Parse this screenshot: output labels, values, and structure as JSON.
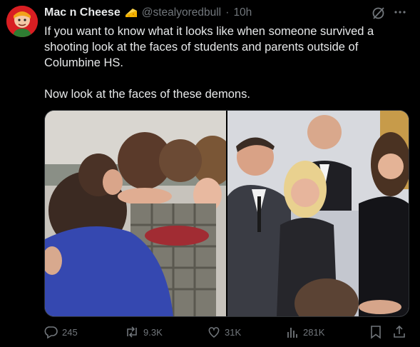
{
  "tweet": {
    "author_name": "Mac n Cheese",
    "author_emoji": "cheese-emoji",
    "handle": "@stealyoredbull",
    "separator": "·",
    "time": "10h",
    "text_paragraph_1": "If you want to know what it looks like when someone survived a shooting look at the faces of students and parents outside of Columbine HS.",
    "text_paragraph_2": "Now look at the faces of these demons.",
    "media": {
      "left_image": "photo-grieving-students-hugging",
      "right_image": "photo-smiling-group-formal-event"
    },
    "stats": {
      "replies": "245",
      "reposts": "9.3K",
      "likes": "31K",
      "views": "281K"
    }
  },
  "colors": {
    "background": "#000000",
    "text": "#e7e9ea",
    "secondary": "#71767b",
    "avatar_red": "#d81e22"
  }
}
